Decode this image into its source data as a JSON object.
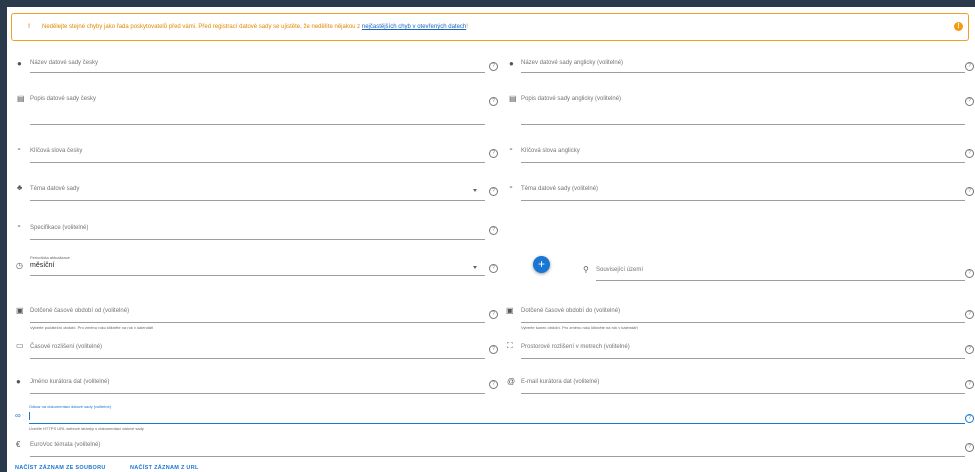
{
  "alert": {
    "icon": "!",
    "text": "Nedělejte stejné chyby jako řada poskytovatelů před vámi. Před registrací datové sady se ujistěte, že nedělíte nějakou z ",
    "link": "nejčastějších chyb v otevřených datech",
    "suffix": "!"
  },
  "fields": {
    "name_cs": "Název datové sady česky",
    "name_en": "Název datové sady anglicky (volitelné)",
    "desc_cs": "Popis datové sady česky",
    "desc_en": "Popis datové sady anglicky (volitelné)",
    "kw_cs": "Klíčová slova česky",
    "kw_en": "Klíčová slova anglicky",
    "theme": "Téma datové sady",
    "theme_en": "Téma datové sady (volitelné)",
    "spec": "Specifikace (volitelné)",
    "periodicity_label": "Periodicita aktualizace",
    "periodicity_value": "měsíční",
    "territory": "Související území",
    "time_from": "Dotčené časové období od (volitelné)",
    "time_from_hint": "Vyberte počáteční období. Pro změnu roku klikněte na rok v kalendáři",
    "time_to": "Dotčené časové období do (volitelné)",
    "time_to_hint": "Vyberte konec období. Pro změnu roku klikněte na rok v kalendáři",
    "time_res": "Časové rozlišení (volitelné)",
    "space_res": "Prostorové rozlišení v metrech (volitelné)",
    "curator_name": "Jméno kurátora dat (volitelné)",
    "curator_email": "E-mail kurátora dat (volitelné)",
    "doc_link_label": "Odkaz na dokumentaci datové sady (volitelné)",
    "doc_link_hint": "Uveďte HTTPS URL webové stránky s dokumentací datové sady",
    "eurovoc": "EuroVoc témata (volitelné)"
  },
  "buttons": {
    "load_file": "NAČÍST ZÁZNAM ZE SOUBORU",
    "load_url": "NAČÍST ZÁZNAM Z URL"
  },
  "fab": "+",
  "help_glyph": "?"
}
